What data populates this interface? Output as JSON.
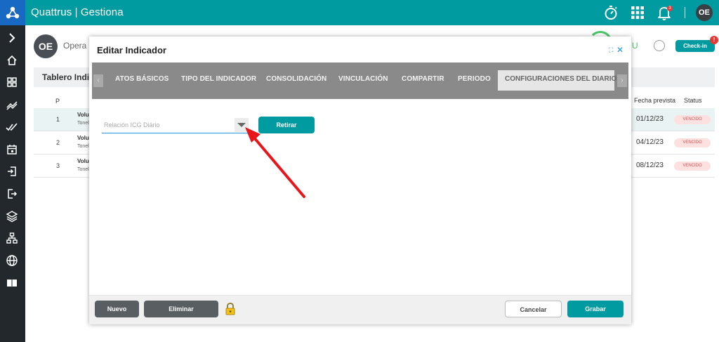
{
  "header": {
    "app_title": "Quattrus | Gestiona",
    "notifications_count": "3",
    "avatar_initials": "OE"
  },
  "sidebar": {
    "items": [
      {
        "icon": "chevron-right-icon"
      },
      {
        "icon": "home-icon"
      },
      {
        "icon": "dashboard-icon"
      },
      {
        "icon": "trend-icon"
      },
      {
        "icon": "double-check-icon"
      },
      {
        "icon": "calendar-icon"
      },
      {
        "icon": "login-icon"
      },
      {
        "icon": "logout-icon"
      },
      {
        "icon": "layers-icon"
      },
      {
        "icon": "org-chart-icon"
      },
      {
        "icon": "globe-icon"
      },
      {
        "icon": "book-icon"
      }
    ]
  },
  "background_page": {
    "user_initials": "OE",
    "user_name": "Opera E",
    "progress_letter": "U",
    "checkin_label": "Check-in",
    "checkin_alert": "!",
    "table_title": "Tablero Indica",
    "col_p": "P",
    "col_fecha": "Fecha prevista",
    "col_status": "Status",
    "rows": [
      {
        "num": "1",
        "name": "Volu",
        "sub": "Tonel",
        "date": "01/12/23",
        "status": "VENCIDO"
      },
      {
        "num": "2",
        "name": "Volu",
        "sub": "Tonel",
        "date": "04/12/23",
        "status": "VENCIDO"
      },
      {
        "num": "3",
        "name": "Volu",
        "sub": "Tonel",
        "date": "08/12/23",
        "status": "VENCIDO"
      }
    ]
  },
  "modal": {
    "title": "Editar Indicador",
    "tabs": [
      "ATOS BÁSICOS",
      "TIPO DEL INDICADOR",
      "CONSOLIDACIÓN",
      "VINCULACIÓN",
      "COMPARTIR",
      "PERIODO"
    ],
    "active_tab": "CONFIGURACIONES DEL DIARIO",
    "field_placeholder": "Relación ICG Diário",
    "retirar_label": "Retirar",
    "footer": {
      "nuevo_label": "Nuevo",
      "eliminar_label": "Eliminar",
      "cancelar_label": "Cancelar",
      "grabar_label": "Grabar"
    }
  },
  "colors": {
    "brand_teal": "#009ba0",
    "logo_blue": "#1769c4",
    "sidebar_dark": "#22282c",
    "annotation_red": "#e8161b",
    "status_red": "#e05252"
  }
}
